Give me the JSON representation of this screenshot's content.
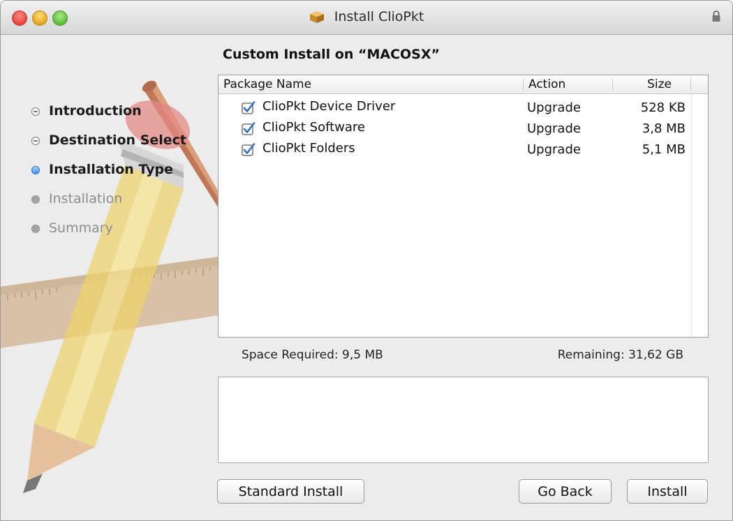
{
  "window": {
    "title": "Install ClioPkt"
  },
  "steps": [
    {
      "label": "Introduction",
      "state": "done"
    },
    {
      "label": "Destination Select",
      "state": "done"
    },
    {
      "label": "Installation Type",
      "state": "current"
    },
    {
      "label": "Installation",
      "state": "future"
    },
    {
      "label": "Summary",
      "state": "future"
    }
  ],
  "main": {
    "heading": "Custom Install on “MACOSX”"
  },
  "table": {
    "headers": {
      "name": "Package Name",
      "action": "Action",
      "size": "Size"
    },
    "rows": [
      {
        "checked": true,
        "name": "ClioPkt Device Driver",
        "action": "Upgrade",
        "size": "528 KB"
      },
      {
        "checked": true,
        "name": "ClioPkt Software",
        "action": "Upgrade",
        "size": "3,8 MB"
      },
      {
        "checked": true,
        "name": "ClioPkt Folders",
        "action": "Upgrade",
        "size": "5,1 MB"
      }
    ]
  },
  "space": {
    "required": "Space Required:  9,5 MB",
    "remaining": "Remaining:  31,62 GB"
  },
  "description": "",
  "buttons": {
    "standard": "Standard Install",
    "back": "Go Back",
    "install": "Install"
  },
  "colors": {
    "accent": "#3d8ef5",
    "checkbox": "#2f6fcf"
  }
}
